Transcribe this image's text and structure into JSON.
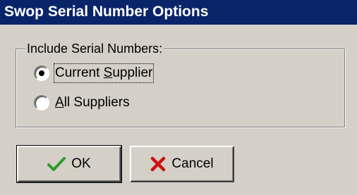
{
  "window": {
    "title": "Swop Serial Number Options"
  },
  "group": {
    "label": "Include Serial Numbers:",
    "options": [
      {
        "label_pre": "Current ",
        "label_mnemonic": "S",
        "label_post": "upplier",
        "selected": true
      },
      {
        "label_pre": "",
        "label_mnemonic": "A",
        "label_post": "ll Suppliers",
        "selected": false
      }
    ]
  },
  "buttons": {
    "ok_label": "OK",
    "cancel_label": "Cancel"
  },
  "icons": {
    "ok": "check-icon",
    "cancel": "x-icon"
  },
  "colors": {
    "titlebar": "#0a246a",
    "face": "#d4d0c8",
    "check": "#2e9b2e",
    "cross": "#d01010"
  }
}
